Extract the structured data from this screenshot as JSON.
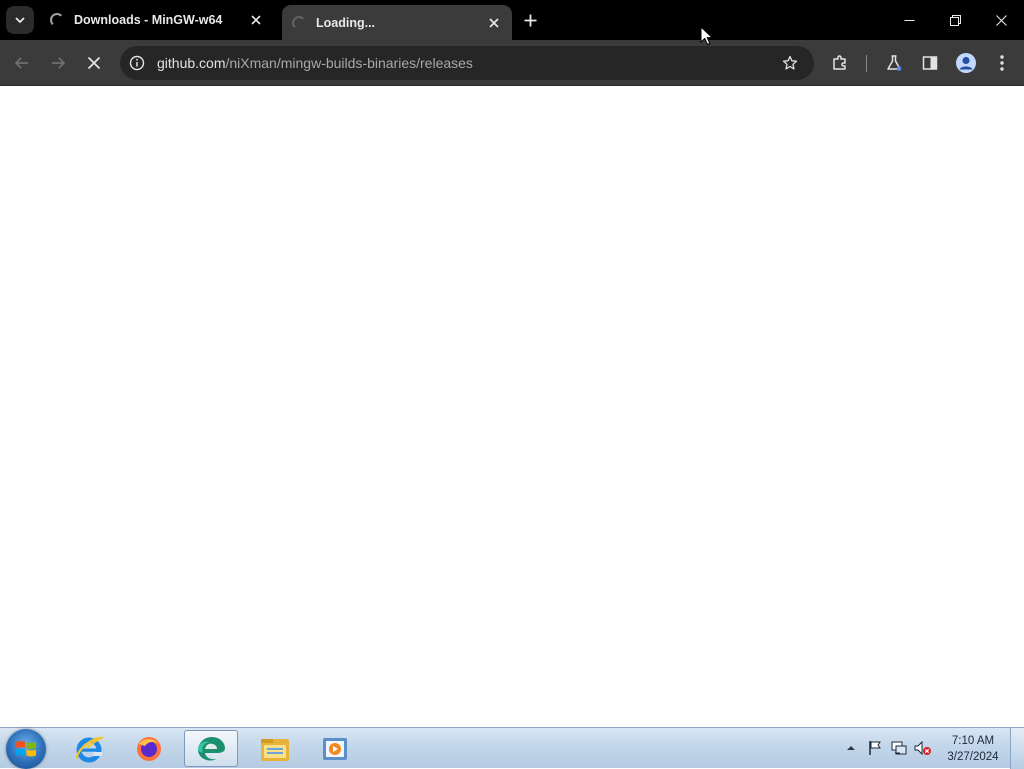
{
  "browser": {
    "tabs": [
      {
        "title": "Downloads - MinGW-w64",
        "loading": true,
        "active": false
      },
      {
        "title": "Loading...",
        "loading": true,
        "active": true
      }
    ],
    "address_host": "github.com",
    "address_path": "/niXman/mingw-builds-binaries/releases",
    "page_loading": true
  },
  "icons": {
    "tab_search": "chevron-down-icon",
    "tab_close": "close-icon",
    "new_tab": "plus-icon",
    "minimize": "minimize-icon",
    "restore": "restore-icon",
    "close_window": "close-icon",
    "back": "back-arrow-icon",
    "forward": "forward-arrow-icon",
    "stop": "stop-loading-icon",
    "site_info": "info-icon",
    "bookmark": "star-icon",
    "extensions": "puzzle-icon",
    "labs": "flask-icon",
    "side_panel": "side-panel-icon",
    "profile": "profile-icon",
    "menu": "more-vertical-icon"
  },
  "taskbar": {
    "pinned": [
      {
        "name": "internet-explorer-icon"
      },
      {
        "name": "firefox-icon"
      },
      {
        "name": "edge-chromium-icon",
        "active": true
      },
      {
        "name": "file-explorer-icon"
      },
      {
        "name": "media-player-icon"
      }
    ],
    "clock_time": "7:10 AM",
    "clock_date": "3/27/2024"
  },
  "colors": {
    "titlebar": "#000000",
    "toolbar": "#3b3b3b",
    "omnibox": "#262626",
    "taskbar": "#c3d6ea"
  }
}
